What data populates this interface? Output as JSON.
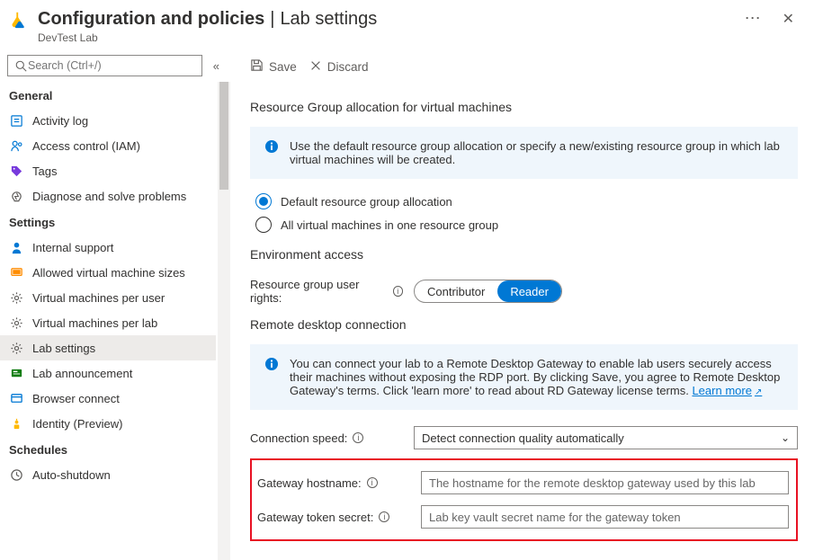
{
  "header": {
    "title_main": "Configuration and policies",
    "title_sub": "Lab settings",
    "subtitle": "DevTest Lab",
    "more": "⋯"
  },
  "search": {
    "placeholder": "Search (Ctrl+/)"
  },
  "sidebar": {
    "groups": [
      {
        "name": "General",
        "items": [
          {
            "label": "Activity log",
            "icon": "activity-log-icon",
            "color": "#0078d4"
          },
          {
            "label": "Access control (IAM)",
            "icon": "access-control-icon",
            "color": "#0078d4"
          },
          {
            "label": "Tags",
            "icon": "tags-icon",
            "color": "#773adc"
          },
          {
            "label": "Diagnose and solve problems",
            "icon": "diagnose-icon",
            "color": "#605e5c"
          }
        ]
      },
      {
        "name": "Settings",
        "items": [
          {
            "label": "Internal support",
            "icon": "internal-support-icon",
            "color": "#0078d4"
          },
          {
            "label": "Allowed virtual machine sizes",
            "icon": "vm-sizes-icon",
            "color": "#ff8c00"
          },
          {
            "label": "Virtual machines per user",
            "icon": "gear-icon",
            "color": "#605e5c"
          },
          {
            "label": "Virtual machines per lab",
            "icon": "gear-icon",
            "color": "#605e5c"
          },
          {
            "label": "Lab settings",
            "icon": "gear-icon",
            "color": "#605e5c",
            "selected": true
          },
          {
            "label": "Lab announcement",
            "icon": "announcement-icon",
            "color": "#107c10"
          },
          {
            "label": "Browser connect",
            "icon": "browser-connect-icon",
            "color": "#0078d4"
          },
          {
            "label": "Identity (Preview)",
            "icon": "identity-icon",
            "color": "#ffb900"
          }
        ]
      },
      {
        "name": "Schedules",
        "items": [
          {
            "label": "Auto-shutdown",
            "icon": "clock-icon",
            "color": "#605e5c"
          }
        ]
      }
    ]
  },
  "toolbar": {
    "save": "Save",
    "discard": "Discard"
  },
  "content": {
    "section1_title": "Resource Group allocation for virtual machines",
    "info1": "Use the default resource group allocation or specify a new/existing resource group in which lab virtual machines will be created.",
    "radio1": "Default resource group allocation",
    "radio2": "All virtual machines in one resource group",
    "env_title": "Environment access",
    "rg_rights_label": "Resource group user rights:",
    "pill_left": "Contributor",
    "pill_right": "Reader",
    "rdc_title": "Remote desktop connection",
    "info2_a": "You can connect your lab to a Remote Desktop Gateway to enable lab users securely access their machines without exposing the RDP port. By clicking Save, you agree to Remote Desktop Gateway's terms.  Click 'learn more' to read about RD Gateway license terms. ",
    "info2_link": "Learn more",
    "conn_speed_label": "Connection speed:",
    "conn_speed_value": "Detect connection quality automatically",
    "gw_host_label": "Gateway hostname:",
    "gw_host_placeholder": "The hostname for the remote desktop gateway used by this lab",
    "gw_token_label": "Gateway token secret:",
    "gw_token_placeholder": "Lab key vault secret name for the gateway token"
  }
}
